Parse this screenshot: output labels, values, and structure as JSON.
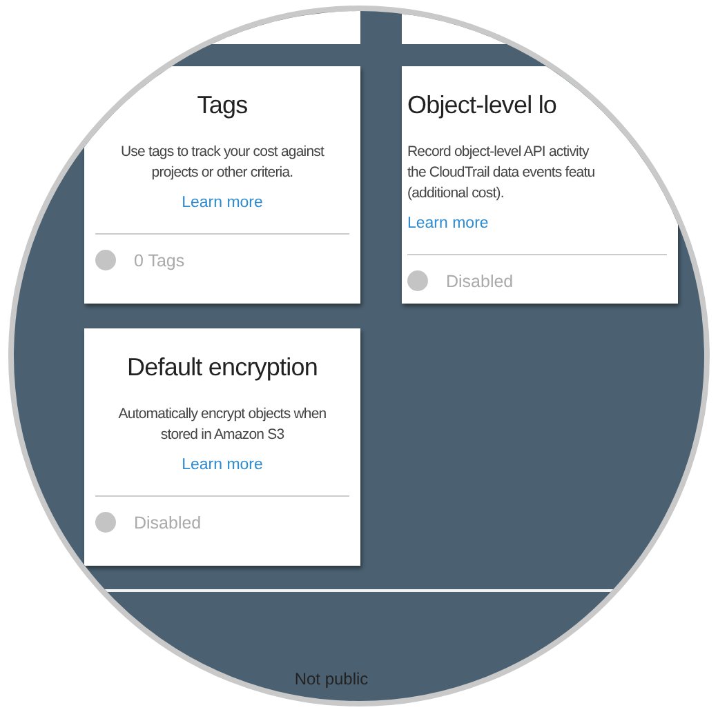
{
  "cards": [
    {
      "title": "Tags",
      "description": [
        "Use tags to track your cost against",
        "projects or other criteria."
      ],
      "link": "Learn more",
      "status": {
        "text": "0 Tags",
        "enabled": false
      }
    },
    {
      "title": "Object-level lo",
      "description": [
        "Record object-level API activity",
        "the CloudTrail data events featu",
        "(additional cost)."
      ],
      "link": "Learn more",
      "status": {
        "text": "Disabled",
        "enabled": false
      }
    },
    {
      "title": "Default encryption",
      "description": [
        "Automatically encrypt objects when",
        "stored in Amazon S3"
      ],
      "link": "Learn more",
      "status": {
        "text": "Disabled",
        "enabled": false
      }
    }
  ],
  "footer_text": "Not public"
}
